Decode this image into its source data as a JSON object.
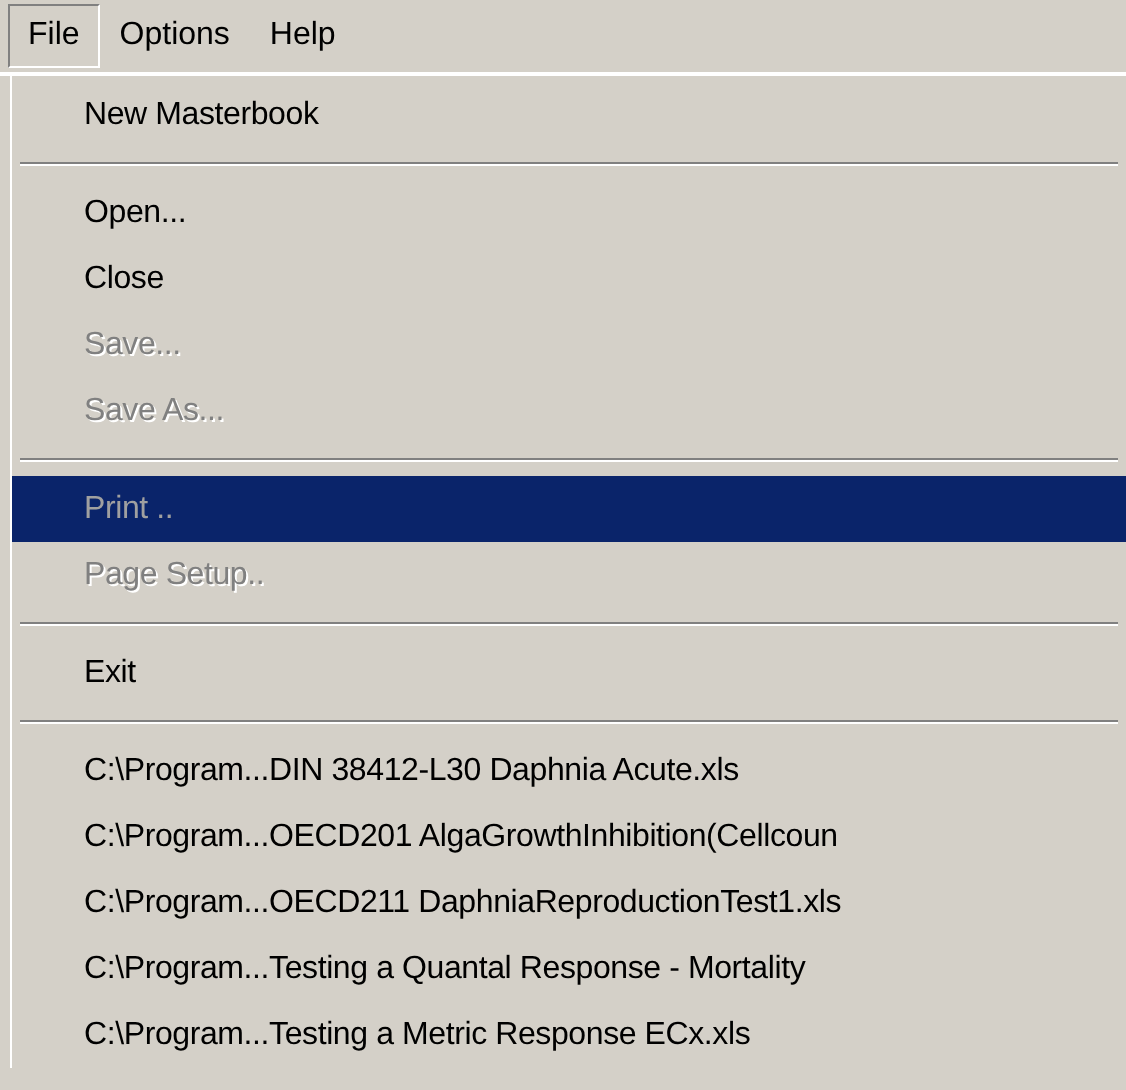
{
  "menubar": [
    {
      "label": "File",
      "selected": true
    },
    {
      "label": "Options",
      "selected": false
    },
    {
      "label": "Help",
      "selected": false
    }
  ],
  "menu": {
    "items": [
      {
        "kind": "item",
        "label": "New Masterbook",
        "disabled": false,
        "selected": false
      },
      {
        "kind": "separator"
      },
      {
        "kind": "item",
        "label": "Open...",
        "disabled": false,
        "selected": false
      },
      {
        "kind": "item",
        "label": "Close",
        "disabled": false,
        "selected": false
      },
      {
        "kind": "item",
        "label": "Save...",
        "disabled": true,
        "selected": false
      },
      {
        "kind": "item",
        "label": "Save As...",
        "disabled": true,
        "selected": false
      },
      {
        "kind": "separator"
      },
      {
        "kind": "item",
        "label": "Print ..",
        "disabled": true,
        "selected": true
      },
      {
        "kind": "item",
        "label": "Page Setup..",
        "disabled": true,
        "selected": false
      },
      {
        "kind": "separator"
      },
      {
        "kind": "item",
        "label": "Exit",
        "disabled": false,
        "selected": false
      },
      {
        "kind": "separator"
      },
      {
        "kind": "item",
        "label": "C:\\Program...DIN 38412-L30 Daphnia Acute.xls",
        "disabled": false,
        "selected": false
      },
      {
        "kind": "item",
        "label": "C:\\Program...OECD201 AlgaGrowthInhibition(Cellcoun",
        "disabled": false,
        "selected": false
      },
      {
        "kind": "item",
        "label": "C:\\Program...OECD211 DaphniaReproductionTest1.xls",
        "disabled": false,
        "selected": false
      },
      {
        "kind": "item",
        "label": "C:\\Program...Testing a Quantal Response - Mortality",
        "disabled": false,
        "selected": false
      },
      {
        "kind": "item",
        "label": "C:\\Program...Testing a Metric Response ECx.xls",
        "disabled": false,
        "selected": false
      }
    ]
  }
}
